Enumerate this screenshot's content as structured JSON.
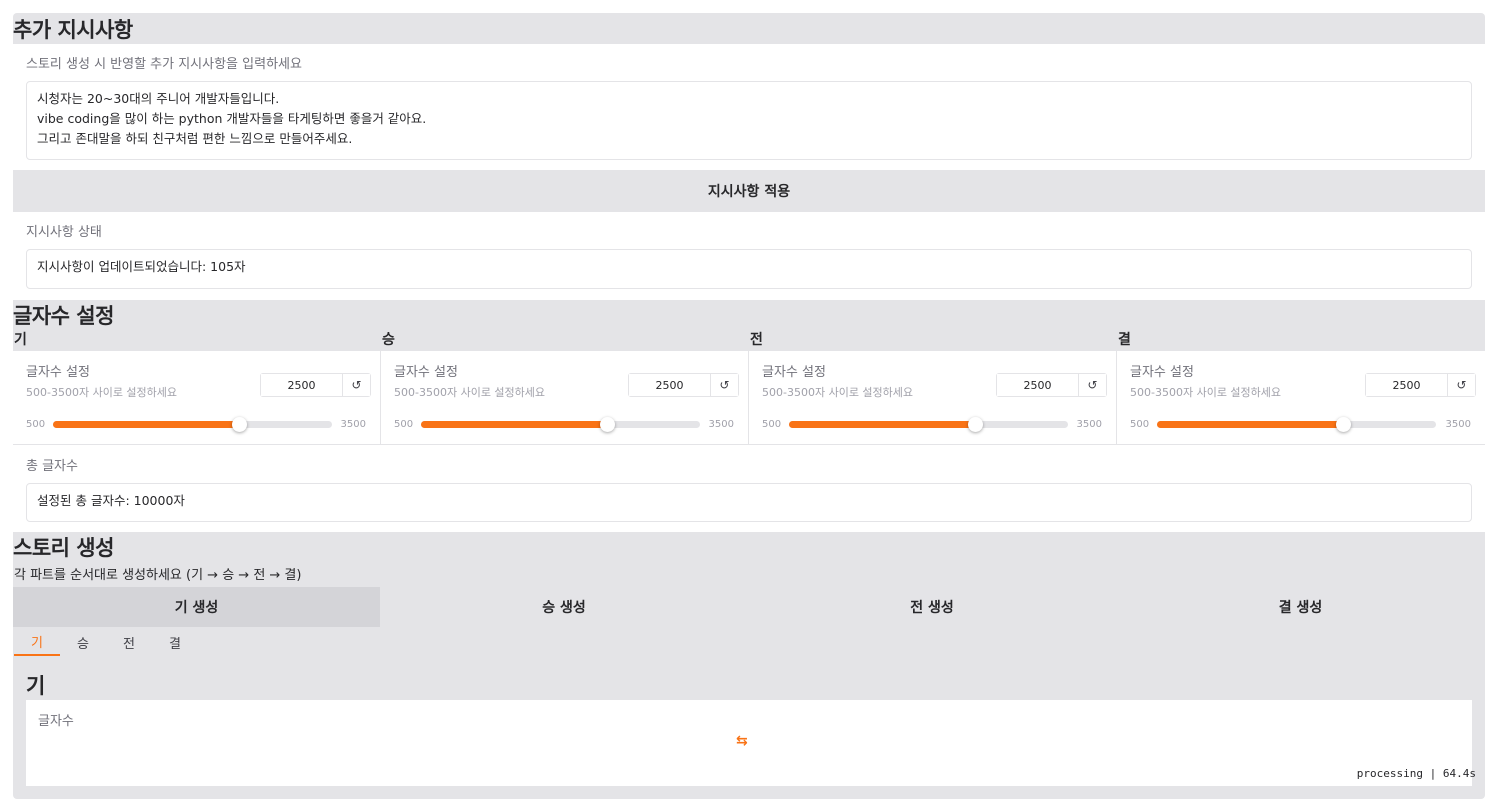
{
  "instructions": {
    "title": "추가 지시사항",
    "field_label": "스토리 생성 시 반영할 추가 지시사항을 입력하세요",
    "lines": [
      "시청자는 20~30대의 주니어 개발자들입니다.",
      "vibe coding을 많이 하는 python 개발자들을 타게팅하면 좋을거 같아요.",
      "그리고 존대말을 하되 친구처럼 편한 느낌으로 만들어주세요."
    ],
    "apply_button": "지시사항 적용",
    "status_label": "지시사항 상태",
    "status_value": "지시사항이 업데이트되었습니다: 105자"
  },
  "length": {
    "title": "글자수 설정",
    "columns": [
      {
        "title": "기",
        "label": "글자수 설정",
        "info": "500-3500자 사이로 설정하세요",
        "value": "2500",
        "min": "500",
        "max": "3500",
        "fraction": 0.667
      },
      {
        "title": "승",
        "label": "글자수 설정",
        "info": "500-3500자 사이로 설정하세요",
        "value": "2500",
        "min": "500",
        "max": "3500",
        "fraction": 0.667
      },
      {
        "title": "전",
        "label": "글자수 설정",
        "info": "500-3500자 사이로 설정하세요",
        "value": "2500",
        "min": "500",
        "max": "3500",
        "fraction": 0.667
      },
      {
        "title": "결",
        "label": "글자수 설정",
        "info": "500-3500자 사이로 설정하세요",
        "value": "2500",
        "min": "500",
        "max": "3500",
        "fraction": 0.667
      }
    ],
    "reset_glyph": "↺",
    "total_label": "총 글자수",
    "total_value": "설정된 총 글자수: 10000자"
  },
  "story": {
    "title": "스토리 생성",
    "subtitle": "각 파트를 순서대로 생성하세요 (기 → 승 → 전 → 결)",
    "buttons": [
      "기 생성",
      "승 생성",
      "전 생성",
      "결 생성"
    ],
    "tabs": [
      "기",
      "승",
      "전",
      "결"
    ],
    "active_tab": 0,
    "section_heading": "기",
    "output_label": "글자수",
    "progress_text": "processing | 64.4s",
    "loader_icon": "⇆"
  },
  "colors": {
    "accent": "#f97316",
    "panel_bg": "#e4e4e7",
    "active_button": "#d4d4d8"
  }
}
